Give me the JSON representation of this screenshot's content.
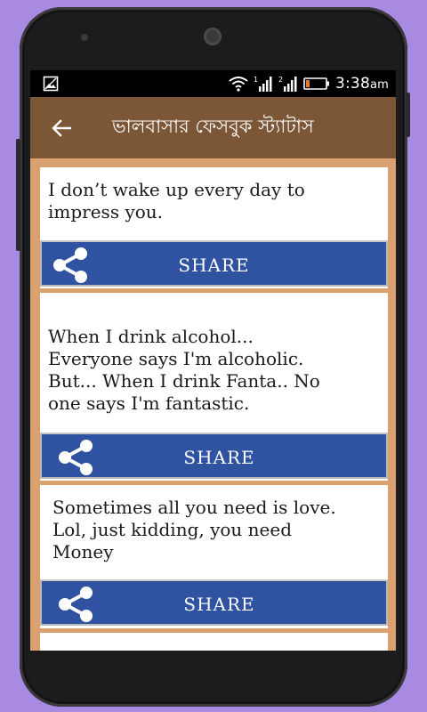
{
  "status_bar": {
    "time": "3:38",
    "time_suffix": "am",
    "icons": [
      "gallery-icon",
      "wifi-icon",
      "signal-1-icon",
      "signal-2-icon",
      "battery-icon"
    ]
  },
  "app_bar": {
    "back_icon": "arrow-left-icon",
    "title": "ভালবাসার ফেসবুক স্ট্যাটাস",
    "background_color": "#7b5737"
  },
  "feed": {
    "background_color": "#daa070",
    "share_color": "#2f53a1",
    "items": [
      {
        "text": " I don’t wake up every day to\nimpress you.",
        "share_label": "SHARE"
      },
      {
        "text": " When I drink alcohol...\nEveryone says I'm alcoholic.\nBut... When I drink Fanta.. No\none says I'm fantastic.",
        "share_label": "SHARE"
      },
      {
        "text": " Sometimes all you need is love.\nLol, just kidding, you need\nMoney",
        "share_label": "SHARE"
      }
    ]
  }
}
